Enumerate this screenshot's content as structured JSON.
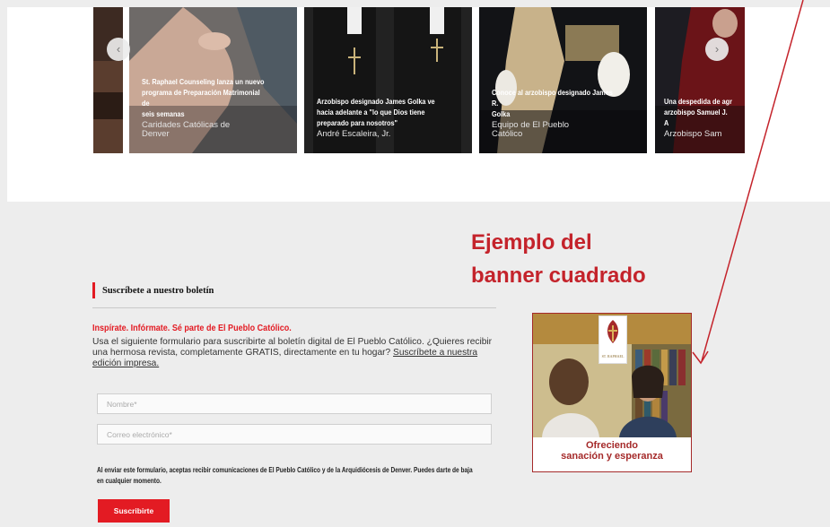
{
  "carousel": {
    "prev_glyph": "‹",
    "next_glyph": "›",
    "articles": [
      {
        "title": "St. Raphael Counseling lanza un nuevo\nprograma de Preparación Matrimonial de\nseis semanas",
        "author": "Caridades Católicas de\nDenver"
      },
      {
        "title": "Arzobispo designado James Golka ve\nhacia adelante a \"lo que Dios tiene\npreparado para nosotros\"",
        "author": "André Escaleira, Jr."
      },
      {
        "title": "Conoce al arzobispo designado James R.\nGolka",
        "author": "Equipo de El Pueblo\nCatólico"
      },
      {
        "title": "Una despedida de agr\narzobispo Samuel J. A",
        "author": "Arzobispo Sam"
      }
    ]
  },
  "annotation": {
    "line1": "Ejemplo del",
    "line2": "banner cuadrado"
  },
  "newsletter": {
    "heading": "Suscríbete a nuestro boletín",
    "tagline": "Inspírate. Infórmate. Sé parte de El Pueblo Católico.",
    "description": "Usa el siguiente formulario para suscribirte al boletín digital de El Pueblo Católico. ¿Quieres recibir una hermosa revista, completamente GRATIS, directamente en tu hogar? ",
    "print_link": "Suscríbete a nuestra edición impresa.",
    "name_placeholder": "Nombre*",
    "email_placeholder": "Correo electrónico*",
    "consent": "Al enviar este formulario, aceptas recibir comunicaciones de El Pueblo Católico y de la Arquidiócesis de Denver. Puedes darte de baja en cualquier momento.",
    "submit_label": "Suscribirte"
  },
  "ad": {
    "logo_text": "ST. RAPHAEL",
    "caption_line1": "Ofreciendo",
    "caption_line2": "sanación y esperanza"
  },
  "colors": {
    "accent_red": "#e31b23",
    "annotation_red": "#c4232b",
    "ad_border": "#a52a2a",
    "background": "#ededed"
  }
}
